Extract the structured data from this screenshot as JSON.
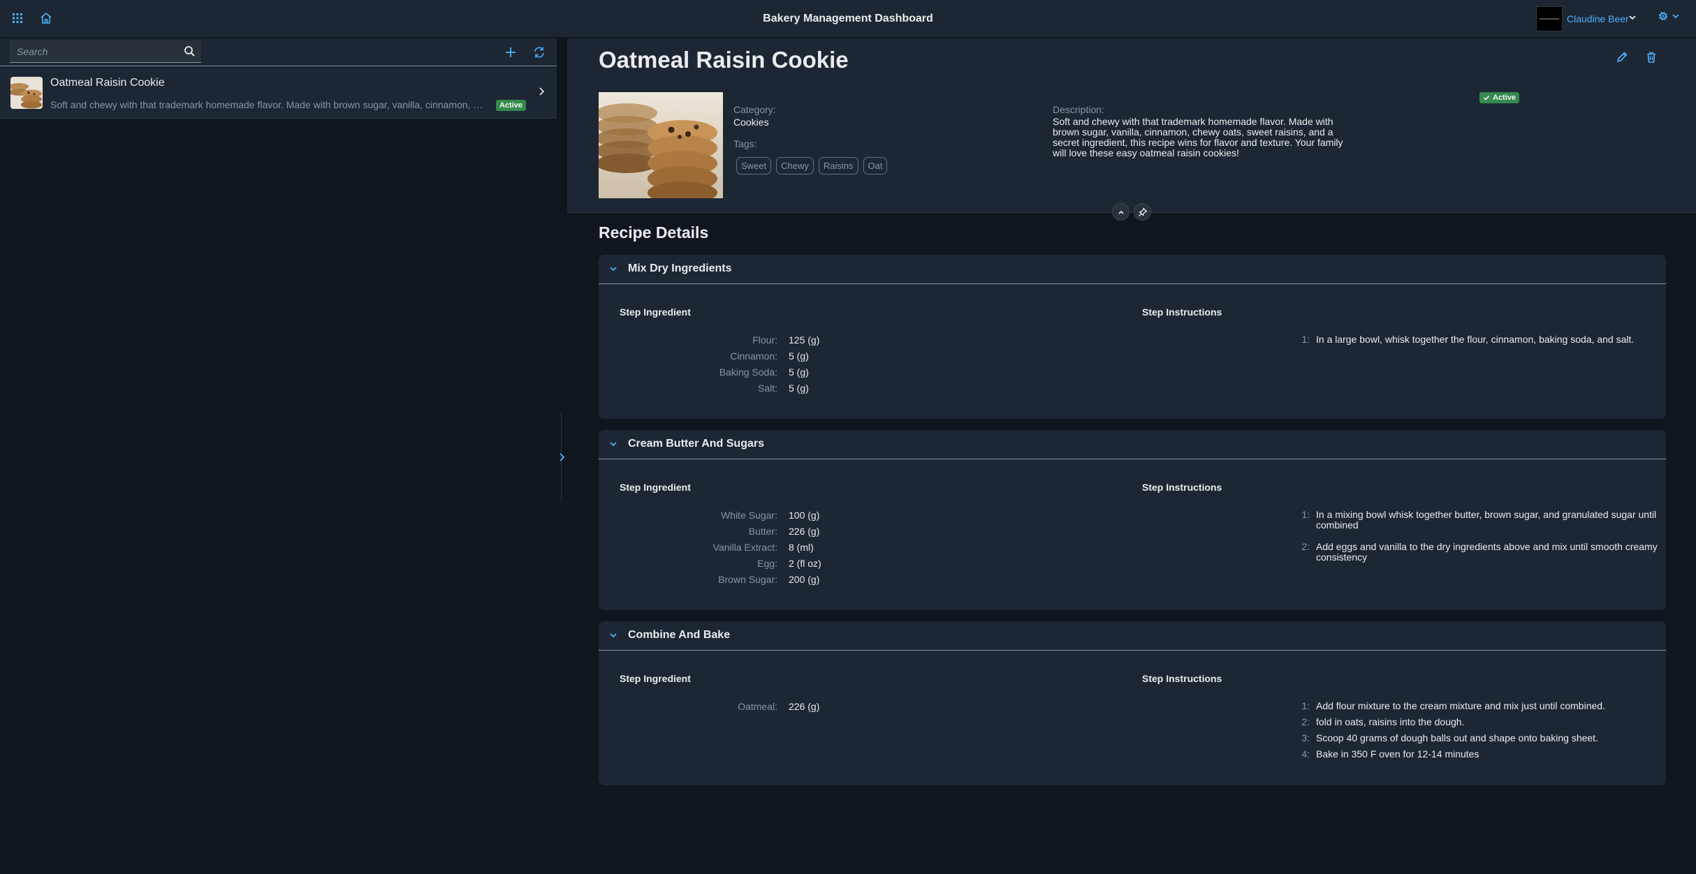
{
  "shell": {
    "title": "Bakery Management Dashboard",
    "user_name": "Claudine Beer",
    "icons": [
      "grid-menu-icon",
      "home-icon",
      "settings-icon"
    ]
  },
  "master": {
    "search_placeholder": "Search",
    "item": {
      "title": "Oatmeal Raisin Cookie",
      "description": "Soft and chewy with that trademark homemade flavor. Made with brown sugar, vanilla, cinnamon, chewy oats, sweet raisins, and a secret ingredient, this recipe wins for flavor and texture. Your family will love these easy oatmeal raisin cookies!",
      "status": "Active"
    }
  },
  "detail": {
    "title": "Oatmeal Raisin Cookie",
    "category_label": "Category:",
    "category_value": "Cookies",
    "tags_label": "Tags:",
    "tags": [
      "Sweet",
      "Chewy",
      "Raisins",
      "Oat"
    ],
    "description_label": "Description:",
    "description": "Soft and chewy with that trademark homemade flavor. Made with brown sugar, vanilla, cinnamon, chewy oats, sweet raisins, and a secret ingredient, this recipe wins for flavor and texture. Your family will love these easy oatmeal raisin cookies!",
    "status": "Active"
  },
  "recipe": {
    "section_title": "Recipe Details",
    "ingredient_header": "Step Ingredient",
    "instructions_header": "Step Instructions",
    "steps": [
      {
        "title": "Mix Dry Ingredients",
        "ingredients": [
          {
            "label": "Flour:",
            "value": "125 (g)"
          },
          {
            "label": "Cinnamon:",
            "value": "5 (g)"
          },
          {
            "label": "Baking Soda:",
            "value": "5 (g)"
          },
          {
            "label": "Salt:",
            "value": "5 (g)"
          }
        ],
        "instructions": [
          {
            "num": "1:",
            "text": "In a large bowl, whisk together the flour, cinnamon, baking soda, and salt."
          }
        ]
      },
      {
        "title": "Cream Butter And Sugars",
        "ingredients": [
          {
            "label": "White Sugar:",
            "value": "100 (g)"
          },
          {
            "label": "Butter:",
            "value": "226 (g)"
          },
          {
            "label": "Vanilla Extract:",
            "value": "8 (ml)"
          },
          {
            "label": "Egg:",
            "value": "2 (fl oz)"
          },
          {
            "label": "Brown Sugar:",
            "value": "200 (g)"
          }
        ],
        "instructions": [
          {
            "num": "1:",
            "text": "In a mixing bowl whisk together butter, brown sugar, and granulated sugar until combined"
          },
          {
            "num": "2:",
            "text": "Add eggs and vanilla to the dry ingredients above and mix until smooth creamy consistency"
          }
        ]
      },
      {
        "title": "Combine And Bake",
        "ingredients": [
          {
            "label": "Oatmeal:",
            "value": "226 (g)"
          }
        ],
        "instructions": [
          {
            "num": "1:",
            "text": "Add flour mixture to the cream mixture and mix just until combined."
          },
          {
            "num": "2:",
            "text": "fold in oats, raisins into the dough."
          },
          {
            "num": "3:",
            "text": "Scoop 40 grams of dough balls out and shape onto baking sheet."
          },
          {
            "num": "4:",
            "text": "Bake in 350 F oven for 12-14 minutes"
          }
        ]
      }
    ]
  },
  "colors": {
    "accent": "#4db1ff",
    "shell_bg": "#1d2733",
    "page_bg": "#0f161d",
    "success": "#358a4d"
  }
}
